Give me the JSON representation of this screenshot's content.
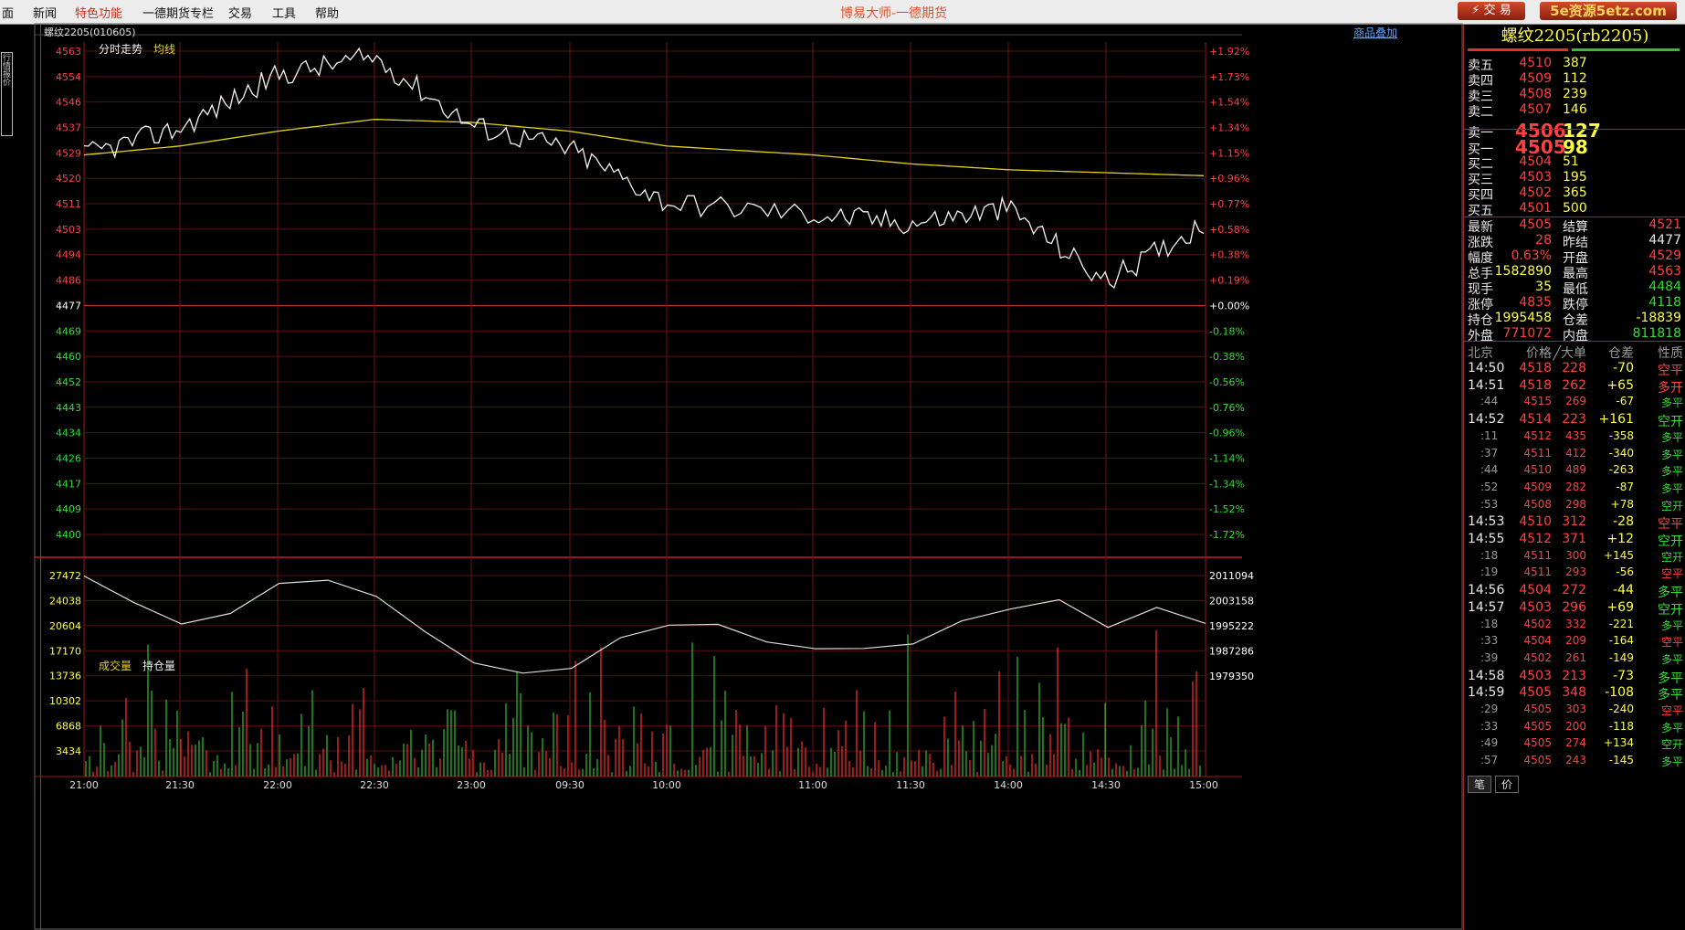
{
  "menu": {
    "items": [
      "面",
      "新闻",
      "特色功能",
      "一德期货专栏",
      "交易",
      "工具",
      "帮助"
    ]
  },
  "app_title": "博易大师-一德期货",
  "trade_button": "交 易",
  "watermark": "5e资源5etz.com",
  "left_tab": "行情报价",
  "chart": {
    "instrument": "螺纹2205(010605)",
    "product_overlay": "商品叠加",
    "labels": {
      "minute_trend": "分时走势",
      "avg_line": "均线",
      "volume": "成交量",
      "open_interest": "持仓量"
    },
    "price_ticks": [
      "4563",
      "4554",
      "4546",
      "4537",
      "4529",
      "4520",
      "4511",
      "4503",
      "4494",
      "4486",
      "4477",
      "4469",
      "4460",
      "4452",
      "4443",
      "4434",
      "4426",
      "4417",
      "4409",
      "4400"
    ],
    "pct_ticks": [
      "+1.92%",
      "+1.73%",
      "+1.54%",
      "+1.34%",
      "+1.15%",
      "+0.96%",
      "+0.77%",
      "+0.58%",
      "+0.38%",
      "+0.19%",
      "+0.00%",
      "-0.18%",
      "-0.38%",
      "-0.56%",
      "-0.76%",
      "-0.96%",
      "-1.14%",
      "-1.34%",
      "-1.52%",
      "-1.72%"
    ],
    "volume_ticks": [
      "27472",
      "24038",
      "20604",
      "17170",
      "13736",
      "10302",
      "6868",
      "3434"
    ],
    "oi_ticks": [
      "2011094",
      "2003158",
      "1995222",
      "1987286",
      "1979350"
    ],
    "time_ticks": [
      "21:00",
      "21:30",
      "22:00",
      "22:30",
      "23:00",
      "09:30",
      "10:00",
      "11:00",
      "11:30",
      "14:00",
      "14:30",
      "15:00"
    ]
  },
  "chart_data": {
    "type": "line",
    "title": "分时走势",
    "x": [
      "21:00",
      "21:30",
      "22:00",
      "22:30",
      "23:00",
      "09:30",
      "10:00",
      "11:00",
      "11:30",
      "14:00",
      "14:30",
      "15:00"
    ],
    "series": [
      {
        "name": "分时走势",
        "values": [
          4528,
          4537,
          4555,
          4561,
          4538,
          4530,
          4512,
          4508,
          4505,
          4510,
          4485,
          4505
        ]
      },
      {
        "name": "均线",
        "values": [
          4528,
          4531,
          4536,
          4540,
          4539,
          4536,
          4531,
          4528,
          4525,
          4523,
          4522,
          4521
        ]
      }
    ],
    "ylim": [
      4400,
      4563
    ],
    "reference_price": 4477,
    "volume_ylim": [
      0,
      27472
    ],
    "open_interest_ylim": [
      1979350,
      2011094
    ]
  },
  "quote": {
    "title": "螺纹2205(rb2205)",
    "sells": [
      {
        "label": "卖五",
        "price": "4510",
        "vol": "387"
      },
      {
        "label": "卖四",
        "price": "4509",
        "vol": "112"
      },
      {
        "label": "卖三",
        "price": "4508",
        "vol": "239"
      },
      {
        "label": "卖二",
        "price": "4507",
        "vol": "146"
      }
    ],
    "sell1": {
      "label": "卖一",
      "price": "4506",
      "vol": "127"
    },
    "buy1": {
      "label": "买一",
      "price": "4505",
      "vol": "98"
    },
    "buys": [
      {
        "label": "买二",
        "price": "4504",
        "vol": "51"
      },
      {
        "label": "买三",
        "price": "4503",
        "vol": "195"
      },
      {
        "label": "买四",
        "price": "4502",
        "vol": "365"
      },
      {
        "label": "买五",
        "price": "4501",
        "vol": "500"
      }
    ],
    "stats": [
      {
        "l1": "最新",
        "v1": "4505",
        "l2": "结算",
        "v2": "4521"
      },
      {
        "l1": "涨跌",
        "v1": "28",
        "l2": "昨结",
        "v2": "4477"
      },
      {
        "l1": "幅度",
        "v1": "0.63%",
        "l2": "开盘",
        "v2": "4529"
      },
      {
        "l1": "总手",
        "v1": "1582890",
        "l2": "最高",
        "v2": "4563"
      },
      {
        "l1": "现手",
        "v1": "35",
        "l2": "最低",
        "v2": "4484"
      },
      {
        "l1": "涨停",
        "v1": "4835",
        "l2": "跌停",
        "v2": "4118"
      },
      {
        "l1": "持仓",
        "v1": "1995458",
        "l2": "仓差",
        "v2": "-18839"
      },
      {
        "l1": "外盘",
        "v1": "771072",
        "l2": "内盘",
        "v2": "811818"
      }
    ],
    "tick_header": {
      "time": "北京",
      "price": "价格",
      "vol": "╱大单",
      "oi": "仓差",
      "nature": "性质"
    },
    "ticks": [
      {
        "t": "14:50",
        "p": "4518",
        "v": "228",
        "oi": "-70",
        "n": "空平"
      },
      {
        "t": "14:51",
        "p": "4518",
        "v": "262",
        "oi": "+65",
        "n": "多开"
      },
      {
        "t": ":44",
        "p": "4515",
        "v": "269",
        "oi": "-67",
        "n": "多平"
      },
      {
        "t": "14:52",
        "p": "4514",
        "v": "223",
        "oi": "+161",
        "n": "空开"
      },
      {
        "t": ":11",
        "p": "4512",
        "v": "435",
        "oi": "-358",
        "n": "多平"
      },
      {
        "t": ":37",
        "p": "4511",
        "v": "412",
        "oi": "-340",
        "n": "多平"
      },
      {
        "t": ":44",
        "p": "4510",
        "v": "489",
        "oi": "-263",
        "n": "多平"
      },
      {
        "t": ":52",
        "p": "4509",
        "v": "282",
        "oi": "-87",
        "n": "多平"
      },
      {
        "t": ":53",
        "p": "4508",
        "v": "298",
        "oi": "+78",
        "n": "空开"
      },
      {
        "t": "14:53",
        "p": "4510",
        "v": "312",
        "oi": "-28",
        "n": "空平"
      },
      {
        "t": "14:55",
        "p": "4512",
        "v": "371",
        "oi": "+12",
        "n": "空开"
      },
      {
        "t": ":18",
        "p": "4511",
        "v": "300",
        "oi": "+145",
        "n": "空开"
      },
      {
        "t": ":19",
        "p": "4511",
        "v": "293",
        "oi": "-56",
        "n": "空平"
      },
      {
        "t": "14:56",
        "p": "4504",
        "v": "272",
        "oi": "-44",
        "n": "多平"
      },
      {
        "t": "14:57",
        "p": "4503",
        "v": "296",
        "oi": "+69",
        "n": "空开"
      },
      {
        "t": ":18",
        "p": "4502",
        "v": "332",
        "oi": "-221",
        "n": "多平"
      },
      {
        "t": ":33",
        "p": "4504",
        "v": "209",
        "oi": "-164",
        "n": "空平"
      },
      {
        "t": ":39",
        "p": "4502",
        "v": "261",
        "oi": "-149",
        "n": "多平"
      },
      {
        "t": "14:58",
        "p": "4503",
        "v": "213",
        "oi": "-73",
        "n": "多平"
      },
      {
        "t": "14:59",
        "p": "4505",
        "v": "348",
        "oi": "-108",
        "n": "多平"
      },
      {
        "t": ":29",
        "p": "4505",
        "v": "303",
        "oi": "-240",
        "n": "空平"
      },
      {
        "t": ":33",
        "p": "4505",
        "v": "200",
        "oi": "-118",
        "n": "多平"
      },
      {
        "t": ":49",
        "p": "4505",
        "v": "274",
        "oi": "+134",
        "n": "空开"
      },
      {
        "t": ":57",
        "p": "4505",
        "v": "243",
        "oi": "-145",
        "n": "多平"
      }
    ],
    "bottom_tabs": [
      "笔",
      "价"
    ]
  }
}
